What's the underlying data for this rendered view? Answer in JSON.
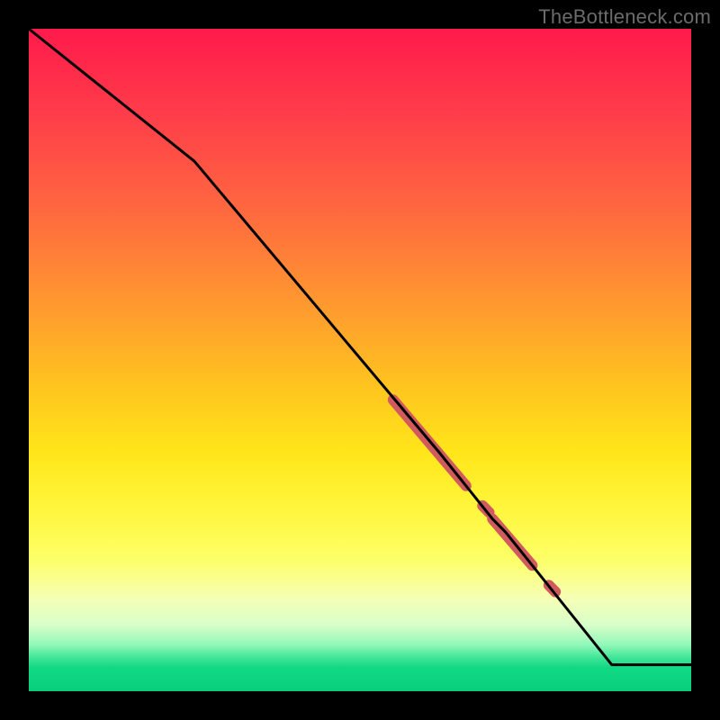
{
  "watermark": "TheBottleneck.com",
  "colors": {
    "line": "#000000",
    "highlight": "#d15a5f",
    "frame_bg": "#000000"
  },
  "chart_data": {
    "type": "line",
    "title": "",
    "xlabel": "",
    "ylabel": "",
    "xlim": [
      0,
      100
    ],
    "ylim": [
      0,
      100
    ],
    "grid": false,
    "legend": false,
    "series": [
      {
        "name": "curve",
        "x": [
          0,
          10,
          25,
          62,
          66,
          70,
          72,
          76,
          80,
          88,
          100
        ],
        "y": [
          100,
          92,
          80,
          36,
          31,
          26,
          24,
          19,
          14,
          4,
          4
        ],
        "note": "y is percent-from-bottom; declining curve with slope break ~x=25 then near-linear descent, flat tail after x≈88"
      }
    ],
    "highlight_segments": [
      {
        "name": "thick-segment-1",
        "x": [
          55,
          66
        ],
        "y": [
          44,
          31
        ]
      },
      {
        "name": "dot-1",
        "x": [
          68.5,
          69.5
        ],
        "y": [
          28,
          27
        ]
      },
      {
        "name": "thick-segment-2",
        "x": [
          70,
          76
        ],
        "y": [
          26,
          19
        ]
      },
      {
        "name": "dot-2",
        "x": [
          78.5,
          79.5
        ],
        "y": [
          16,
          15
        ]
      }
    ]
  }
}
